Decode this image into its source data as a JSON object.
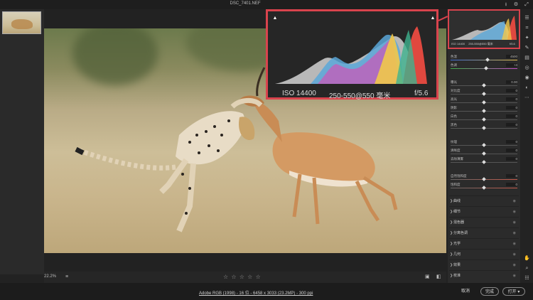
{
  "window": {
    "title": "DSC_7401.NEF"
  },
  "zoom_hist": {
    "metrics": {
      "iso": "ISO 14400",
      "focal": "250-550@550 毫米",
      "aperture": "f/5.6"
    }
  },
  "mini_hist": {
    "metrics": {
      "iso": "ISO 14400",
      "focal": "250-550@550 毫米",
      "aperture": "f/5.6"
    }
  },
  "sliders": [
    {
      "label": "色温",
      "value": "4500"
    },
    {
      "label": "色调",
      "value": "+4"
    },
    {
      "label": "曝光",
      "value": "0.00"
    },
    {
      "label": "对比度",
      "value": "0"
    },
    {
      "label": "高光",
      "value": "0"
    },
    {
      "label": "阴影",
      "value": "0"
    },
    {
      "label": "白色",
      "value": "0"
    },
    {
      "label": "黑色",
      "value": "0"
    },
    {
      "label": "纹理",
      "value": "0"
    },
    {
      "label": "清晰度",
      "value": "0"
    },
    {
      "label": "去除薄雾",
      "value": "0"
    },
    {
      "label": "自然饱和度",
      "value": "0"
    },
    {
      "label": "饱和度",
      "value": "0"
    }
  ],
  "sections": [
    "曲线",
    "细节",
    "混色器",
    "分离色调",
    "光学",
    "几何",
    "效果",
    "校准"
  ],
  "bottombar": {
    "zoom": "22.2%",
    "stars": "☆ ☆ ☆ ☆ ☆"
  },
  "footer": {
    "info": "Adobe RGB (1998) - 16 位 - 6458 x 3033 (23.2MP) - 300 ppi",
    "cancel": "取消",
    "done": "完成",
    "open": "打开"
  },
  "colors": {
    "accent_red": "#d9434d",
    "panel_bg": "#2b2b2b"
  }
}
